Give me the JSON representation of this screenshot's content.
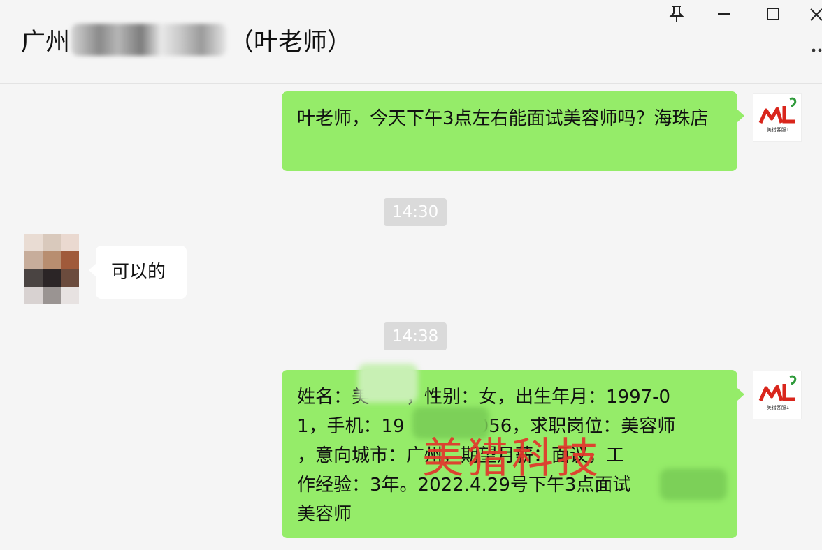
{
  "window": {
    "title_prefix": "广州",
    "title_suffix": "（叶老师）",
    "controls": {
      "pin_icon": "pin-icon",
      "minimize_icon": "minimize-icon",
      "maximize_icon": "maximize-icon",
      "close_icon": "close-icon",
      "more_icon": "more-icon"
    }
  },
  "messages": [
    {
      "direction": "out",
      "text": "叶老师，今天下午3点左右能面试美容师吗？海珠店"
    },
    {
      "type": "time",
      "text": "14:30"
    },
    {
      "direction": "in",
      "text": "可以的"
    },
    {
      "type": "time",
      "text": "14:38"
    },
    {
      "direction": "out",
      "lines": [
        "姓名：美　　，性别：女，出生年月：1997-0",
        "1，手机：19　　　　056，求职岗位：美容师",
        "，意向城市：广州，期望月薪：面议，工",
        "作经验：3年。2022.4.29号下午3点面试　　",
        "美容师"
      ]
    }
  ],
  "avatar_logo": {
    "mark": "ML",
    "caption": "美猎客服1"
  },
  "watermark": "美猎科技",
  "colors": {
    "outgoing_bubble": "#95ec69",
    "incoming_bubble": "#ffffff",
    "background": "#f5f5f5",
    "timestamp_bg": "#dadada",
    "watermark": "#e3352c",
    "logo_red": "#d9261c",
    "logo_green": "#2e9a3a"
  }
}
